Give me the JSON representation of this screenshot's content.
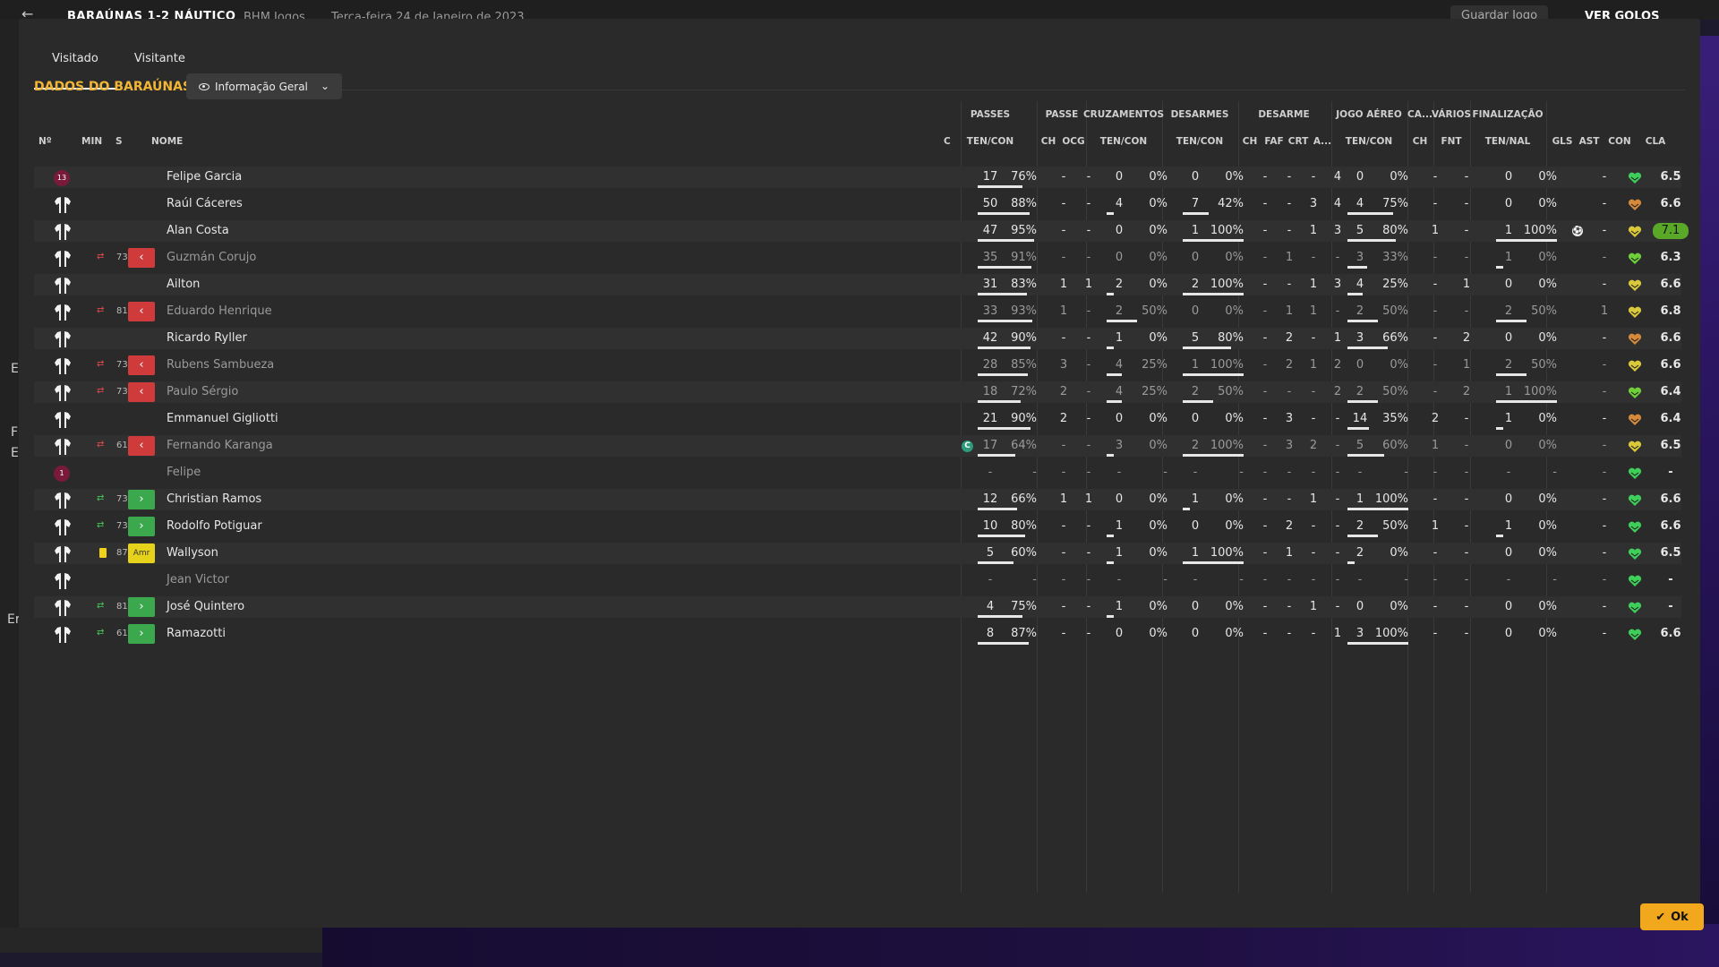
{
  "topbar": {
    "match_title": "BARAÚNAS 1-2 NÁUTICO",
    "competition": "BHM Jogos",
    "date": "Terça-feira 24 de Janeiro de 2023",
    "save_label": "Guardar Jogo",
    "goals_label": "VER GOLOS"
  },
  "tabs": [
    {
      "label": "Visitado",
      "active": true
    },
    {
      "label": "Visitante",
      "active": false
    }
  ],
  "section_title": "DADOS DO BARAÚNAS",
  "view_dropdown": {
    "selected": "Informação Geral"
  },
  "groups": {
    "passes": "PASSES",
    "passe": "PASSE",
    "cruzamentos": "CRUZAMENTOS",
    "desarmes": "DESARMES",
    "desarme": "DESARME",
    "jogo_aereo": "JOGO AÉREO",
    "ca": "CA...",
    "varios": "VÁRIOS",
    "finalizacao": "FINALIZAÇÃO"
  },
  "columns": {
    "n": "Nº",
    "min": "MIN",
    "s": "S",
    "nome": "NOME",
    "c": "C",
    "passes": "TEN/CON",
    "passe_ch": "CH",
    "passe_ocg": "OCG",
    "cruz": "TEN/CON",
    "desarmes": "TEN/CON",
    "des_ch": "CH",
    "des_faf": "FAF",
    "des_crt": "CRT",
    "des_a": "A...",
    "aereo": "TEN/CON",
    "ca_ch": "CH",
    "fnt": "FNT",
    "finaliz": "TEN/NAL",
    "gls": "GLS",
    "ast": "AST",
    "con": "CON",
    "cla": "CLA"
  },
  "players": [
    {
      "name": "Felipe Garcia",
      "kit": "gk",
      "num": "13",
      "min": "",
      "sub": "",
      "passes": [
        "17",
        "76%"
      ],
      "p_ch": "-",
      "p_ocg": "-",
      "cruz": [
        "0",
        "0%"
      ],
      "desar": [
        "0",
        "0%"
      ],
      "d_ch": "-",
      "d_faf": "-",
      "d_crt": "-",
      "d_a": "4",
      "aereo": [
        "0",
        "0%"
      ],
      "ca_ch": "-",
      "fnt": "-",
      "fin": [
        "0",
        "0%"
      ],
      "gls": "",
      "ast": "-",
      "cla": "6.5",
      "heart": "#3ecf5a",
      "pass_pct": 0.76
    },
    {
      "name": "Raúl Cáceres",
      "kit": "field",
      "min": "",
      "sub": "",
      "passes": [
        "50",
        "88%"
      ],
      "p_ch": "-",
      "p_ocg": "-",
      "cruz": [
        "4",
        "0%"
      ],
      "desar": [
        "7",
        "42%"
      ],
      "d_ch": "-",
      "d_faf": "-",
      "d_crt": "3",
      "d_a": "4",
      "aereo": [
        "4",
        "75%"
      ],
      "ca_ch": "-",
      "fnt": "-",
      "fin": [
        "0",
        "0%"
      ],
      "gls": "",
      "ast": "-",
      "cla": "6.6",
      "heart": "#d48a3a",
      "pass_pct": 0.88
    },
    {
      "name": "Alan Costa",
      "kit": "field",
      "min": "",
      "sub": "",
      "passes": [
        "47",
        "95%"
      ],
      "p_ch": "-",
      "p_ocg": "-",
      "cruz": [
        "0",
        "0%"
      ],
      "desar": [
        "1",
        "100%"
      ],
      "d_ch": "-",
      "d_faf": "-",
      "d_crt": "1",
      "d_a": "3",
      "aereo": [
        "5",
        "80%"
      ],
      "ca_ch": "1",
      "fnt": "-",
      "fin": [
        "1",
        "100%"
      ],
      "gls": "goal",
      "ast": "-",
      "cla": "7.1",
      "best": true,
      "heart": "#d8c83a",
      "pass_pct": 0.95
    },
    {
      "name": "Guzmán Corujo",
      "kit": "field",
      "min": "73",
      "sub": "off",
      "dim": true,
      "passes": [
        "35",
        "91%"
      ],
      "p_ch": "-",
      "p_ocg": "-",
      "cruz": [
        "0",
        "0%"
      ],
      "desar": [
        "0",
        "0%"
      ],
      "d_ch": "-",
      "d_faf": "1",
      "d_crt": "-",
      "d_a": "-",
      "aereo": [
        "3",
        "33%"
      ],
      "ca_ch": "-",
      "fnt": "-",
      "fin": [
        "1",
        "0%"
      ],
      "gls": "",
      "ast": "-",
      "cla": "6.3",
      "heart": "#6fcf3a",
      "pass_pct": 0.91
    },
    {
      "name": "Ailton",
      "kit": "field",
      "min": "",
      "sub": "",
      "passes": [
        "31",
        "83%"
      ],
      "p_ch": "1",
      "p_ocg": "1",
      "cruz": [
        "2",
        "0%"
      ],
      "desar": [
        "2",
        "100%"
      ],
      "d_ch": "-",
      "d_faf": "-",
      "d_crt": "1",
      "d_a": "3",
      "aereo": [
        "4",
        "25%"
      ],
      "ca_ch": "-",
      "fnt": "1",
      "fin": [
        "0",
        "0%"
      ],
      "gls": "",
      "ast": "-",
      "cla": "6.6",
      "heart": "#d8c83a",
      "pass_pct": 0.83
    },
    {
      "name": "Eduardo Henrique",
      "kit": "field",
      "min": "81",
      "sub": "off",
      "dim": true,
      "passes": [
        "33",
        "93%"
      ],
      "p_ch": "1",
      "p_ocg": "-",
      "cruz": [
        "2",
        "50%"
      ],
      "desar": [
        "0",
        "0%"
      ],
      "d_ch": "-",
      "d_faf": "1",
      "d_crt": "1",
      "d_a": "-",
      "aereo": [
        "2",
        "50%"
      ],
      "ca_ch": "-",
      "fnt": "-",
      "fin": [
        "2",
        "50%"
      ],
      "gls": "",
      "ast": "1",
      "cla": "6.8",
      "heart": "#d8c83a",
      "pass_pct": 0.93
    },
    {
      "name": "Ricardo Ryller",
      "kit": "field",
      "min": "",
      "sub": "",
      "passes": [
        "42",
        "90%"
      ],
      "p_ch": "-",
      "p_ocg": "-",
      "cruz": [
        "1",
        "0%"
      ],
      "desar": [
        "5",
        "80%"
      ],
      "d_ch": "-",
      "d_faf": "2",
      "d_crt": "-",
      "d_a": "1",
      "aereo": [
        "3",
        "66%"
      ],
      "ca_ch": "-",
      "fnt": "2",
      "fin": [
        "0",
        "0%"
      ],
      "gls": "",
      "ast": "-",
      "cla": "6.6",
      "heart": "#d48a3a",
      "pass_pct": 0.9
    },
    {
      "name": "Rubens Sambueza",
      "kit": "field",
      "min": "73",
      "sub": "off",
      "dim": true,
      "passes": [
        "28",
        "85%"
      ],
      "p_ch": "3",
      "p_ocg": "-",
      "cruz": [
        "4",
        "25%"
      ],
      "desar": [
        "1",
        "100%"
      ],
      "d_ch": "-",
      "d_faf": "2",
      "d_crt": "1",
      "d_a": "2",
      "aereo": [
        "0",
        "0%"
      ],
      "ca_ch": "-",
      "fnt": "1",
      "fin": [
        "2",
        "50%"
      ],
      "gls": "",
      "ast": "-",
      "cla": "6.6",
      "heart": "#d8c83a",
      "pass_pct": 0.85
    },
    {
      "name": "Paulo Sérgio",
      "kit": "field",
      "min": "73",
      "sub": "off",
      "dim": true,
      "passes": [
        "18",
        "72%"
      ],
      "p_ch": "2",
      "p_ocg": "-",
      "cruz": [
        "4",
        "25%"
      ],
      "desar": [
        "2",
        "50%"
      ],
      "d_ch": "-",
      "d_faf": "-",
      "d_crt": "-",
      "d_a": "2",
      "aereo": [
        "2",
        "50%"
      ],
      "ca_ch": "-",
      "fnt": "2",
      "fin": [
        "1",
        "100%"
      ],
      "gls": "",
      "ast": "-",
      "cla": "6.4",
      "heart": "#6fcf3a",
      "pass_pct": 0.72
    },
    {
      "name": "Emmanuel Gigliotti",
      "kit": "field",
      "min": "",
      "sub": "",
      "passes": [
        "21",
        "90%"
      ],
      "p_ch": "2",
      "p_ocg": "-",
      "cruz": [
        "0",
        "0%"
      ],
      "desar": [
        "0",
        "0%"
      ],
      "d_ch": "-",
      "d_faf": "3",
      "d_crt": "-",
      "d_a": "-",
      "aereo": [
        "14",
        "35%"
      ],
      "ca_ch": "2",
      "fnt": "-",
      "fin": [
        "1",
        "0%"
      ],
      "gls": "",
      "ast": "-",
      "cla": "6.4",
      "heart": "#d48a3a",
      "pass_pct": 0.9
    },
    {
      "name": "Fernando Karanga",
      "kit": "field",
      "min": "61",
      "sub": "off",
      "dim": true,
      "captain": true,
      "passes": [
        "17",
        "64%"
      ],
      "p_ch": "-",
      "p_ocg": "-",
      "cruz": [
        "3",
        "0%"
      ],
      "desar": [
        "2",
        "100%"
      ],
      "d_ch": "-",
      "d_faf": "3",
      "d_crt": "2",
      "d_a": "-",
      "aereo": [
        "5",
        "60%"
      ],
      "ca_ch": "1",
      "fnt": "-",
      "fin": [
        "0",
        "0%"
      ],
      "gls": "",
      "ast": "-",
      "cla": "6.5",
      "heart": "#d8c83a",
      "pass_pct": 0.64
    },
    {
      "name": "Felipe",
      "kit": "gk-sub",
      "num": "1",
      "min": "",
      "sub": "",
      "dim": true,
      "passes": [
        "-",
        "-"
      ],
      "p_ch": "-",
      "p_ocg": "-",
      "cruz": [
        "-",
        "-"
      ],
      "desar": [
        "-",
        "-"
      ],
      "d_ch": "-",
      "d_faf": "-",
      "d_crt": "-",
      "d_a": "-",
      "aereo": [
        "-",
        "-"
      ],
      "ca_ch": "-",
      "fnt": "-",
      "fin": [
        "-",
        "-"
      ],
      "gls": "",
      "ast": "-",
      "cla": "-",
      "heart": "#3ecf5a",
      "pass_pct": 0
    },
    {
      "name": "Christian Ramos",
      "kit": "field",
      "min": "73",
      "sub": "on",
      "passes": [
        "12",
        "66%"
      ],
      "p_ch": "1",
      "p_ocg": "1",
      "cruz": [
        "0",
        "0%"
      ],
      "desar": [
        "1",
        "0%"
      ],
      "d_ch": "-",
      "d_faf": "-",
      "d_crt": "1",
      "d_a": "-",
      "aereo": [
        "1",
        "100%"
      ],
      "ca_ch": "-",
      "fnt": "-",
      "fin": [
        "0",
        "0%"
      ],
      "gls": "",
      "ast": "-",
      "cla": "6.6",
      "heart": "#3ecf5a",
      "pass_pct": 0.66
    },
    {
      "name": "Rodolfo Potiguar",
      "kit": "field",
      "min": "73",
      "sub": "on",
      "passes": [
        "10",
        "80%"
      ],
      "p_ch": "-",
      "p_ocg": "-",
      "cruz": [
        "1",
        "0%"
      ],
      "desar": [
        "0",
        "0%"
      ],
      "d_ch": "-",
      "d_faf": "2",
      "d_crt": "-",
      "d_a": "-",
      "aereo": [
        "2",
        "50%"
      ],
      "ca_ch": "1",
      "fnt": "-",
      "fin": [
        "1",
        "0%"
      ],
      "gls": "",
      "ast": "-",
      "cla": "6.6",
      "heart": "#3ecf5a",
      "pass_pct": 0.8
    },
    {
      "name": "Wallyson",
      "kit": "field",
      "min": "87",
      "sub": "card",
      "status_label": "Amr",
      "passes": [
        "5",
        "60%"
      ],
      "p_ch": "-",
      "p_ocg": "-",
      "cruz": [
        "1",
        "0%"
      ],
      "desar": [
        "1",
        "100%"
      ],
      "d_ch": "-",
      "d_faf": "1",
      "d_crt": "-",
      "d_a": "-",
      "aereo": [
        "2",
        "0%"
      ],
      "ca_ch": "-",
      "fnt": "-",
      "fin": [
        "0",
        "0%"
      ],
      "gls": "",
      "ast": "-",
      "cla": "6.5",
      "heart": "#3ecf5a",
      "pass_pct": 0.6
    },
    {
      "name": "Jean Victor",
      "kit": "field",
      "min": "",
      "sub": "",
      "dim": true,
      "passes": [
        "-",
        "-"
      ],
      "p_ch": "-",
      "p_ocg": "-",
      "cruz": [
        "-",
        "-"
      ],
      "desar": [
        "-",
        "-"
      ],
      "d_ch": "-",
      "d_faf": "-",
      "d_crt": "-",
      "d_a": "-",
      "aereo": [
        "-",
        "-"
      ],
      "ca_ch": "-",
      "fnt": "-",
      "fin": [
        "-",
        "-"
      ],
      "gls": "",
      "ast": "-",
      "cla": "-",
      "heart": "#3ecf5a",
      "pass_pct": 0
    },
    {
      "name": "José Quintero",
      "kit": "field",
      "min": "81",
      "sub": "on",
      "passes": [
        "4",
        "75%"
      ],
      "p_ch": "-",
      "p_ocg": "-",
      "cruz": [
        "1",
        "0%"
      ],
      "desar": [
        "0",
        "0%"
      ],
      "d_ch": "-",
      "d_faf": "-",
      "d_crt": "1",
      "d_a": "-",
      "aereo": [
        "0",
        "0%"
      ],
      "ca_ch": "-",
      "fnt": "-",
      "fin": [
        "0",
        "0%"
      ],
      "gls": "",
      "ast": "-",
      "cla": "-",
      "heart": "#3ecf5a",
      "pass_pct": 0.75
    },
    {
      "name": "Ramazotti",
      "kit": "field",
      "min": "61",
      "sub": "on",
      "passes": [
        "8",
        "87%"
      ],
      "p_ch": "-",
      "p_ocg": "-",
      "cruz": [
        "0",
        "0%"
      ],
      "desar": [
        "0",
        "0%"
      ],
      "d_ch": "-",
      "d_faf": "-",
      "d_crt": "-",
      "d_a": "1",
      "aereo": [
        "3",
        "100%"
      ],
      "ca_ch": "-",
      "fnt": "-",
      "fin": [
        "0",
        "0%"
      ],
      "gls": "",
      "ast": "-",
      "cla": "6.6",
      "heart": "#3ecf5a",
      "pass_pct": 0.87
    }
  ],
  "ok_label": "Ok",
  "background_letters": [
    "E",
    "F",
    "E",
    "Er"
  ]
}
